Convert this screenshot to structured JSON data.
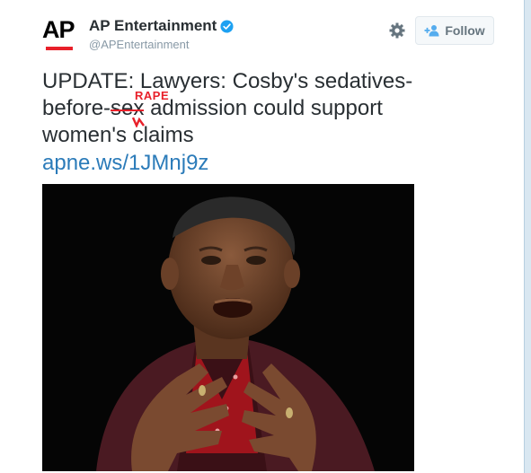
{
  "account": {
    "logo_text": "AP",
    "display_name": "AP Entertainment",
    "handle": "@APEntertainment",
    "verified": true
  },
  "actions": {
    "follow_label": "Follow"
  },
  "tweet": {
    "line1": "UPDATE: Lawyers: Cosby's sedatives-",
    "line2_before": "before-",
    "line2_struck": "sex",
    "line2_after": " admission could support",
    "line3": "women's claims",
    "correction_label": "RAPE",
    "link": "apne.ws/1JMnj9z"
  },
  "colors": {
    "brand_red": "#e8202a",
    "link_blue": "#2b7bb9",
    "verified_blue": "#1da1f2",
    "handle_gray": "#8899a6"
  },
  "icons": {
    "settings": "gear-icon",
    "follow": "add-user-icon",
    "verified": "verified-badge-icon"
  }
}
